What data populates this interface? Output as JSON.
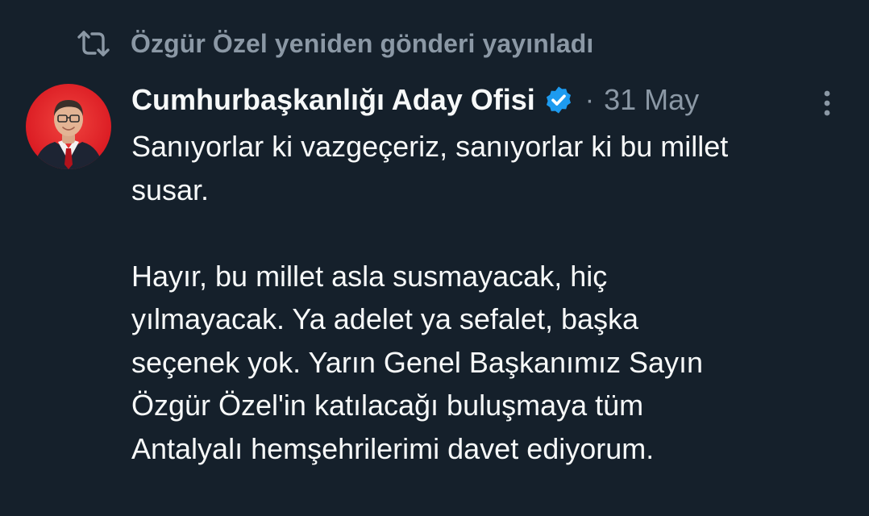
{
  "repost": {
    "icon": "repost-icon",
    "text": "Özgür Özel yeniden gönderi yayınladı"
  },
  "author": {
    "display_name": "Cumhurbaşkanlığı Aday Ofisi",
    "verified_icon": "verified-badge-icon",
    "separator": "·",
    "date": "31 May"
  },
  "tweet": {
    "lines": [
      "Sanıyorlar ki vazgeçeriz, sanıyorlar ki bu millet",
      "susar.",
      "",
      "Hayır, bu millet asla susmayacak, hiç",
      "yılmayacak. Ya adelet ya sefalet, başka",
      "seçenek yok. Yarın Genel Başkanımız Sayın",
      "Özgür Özel'in katılacağı buluşmaya tüm",
      "Antalyalı hemşehrilerimi davet ediyorum."
    ]
  },
  "colors": {
    "background": "#15202b",
    "text_primary": "#f7f9f9",
    "text_secondary": "#8b98a5",
    "verified_blue": "#1d9bf0",
    "avatar_red": "#e5212a"
  }
}
